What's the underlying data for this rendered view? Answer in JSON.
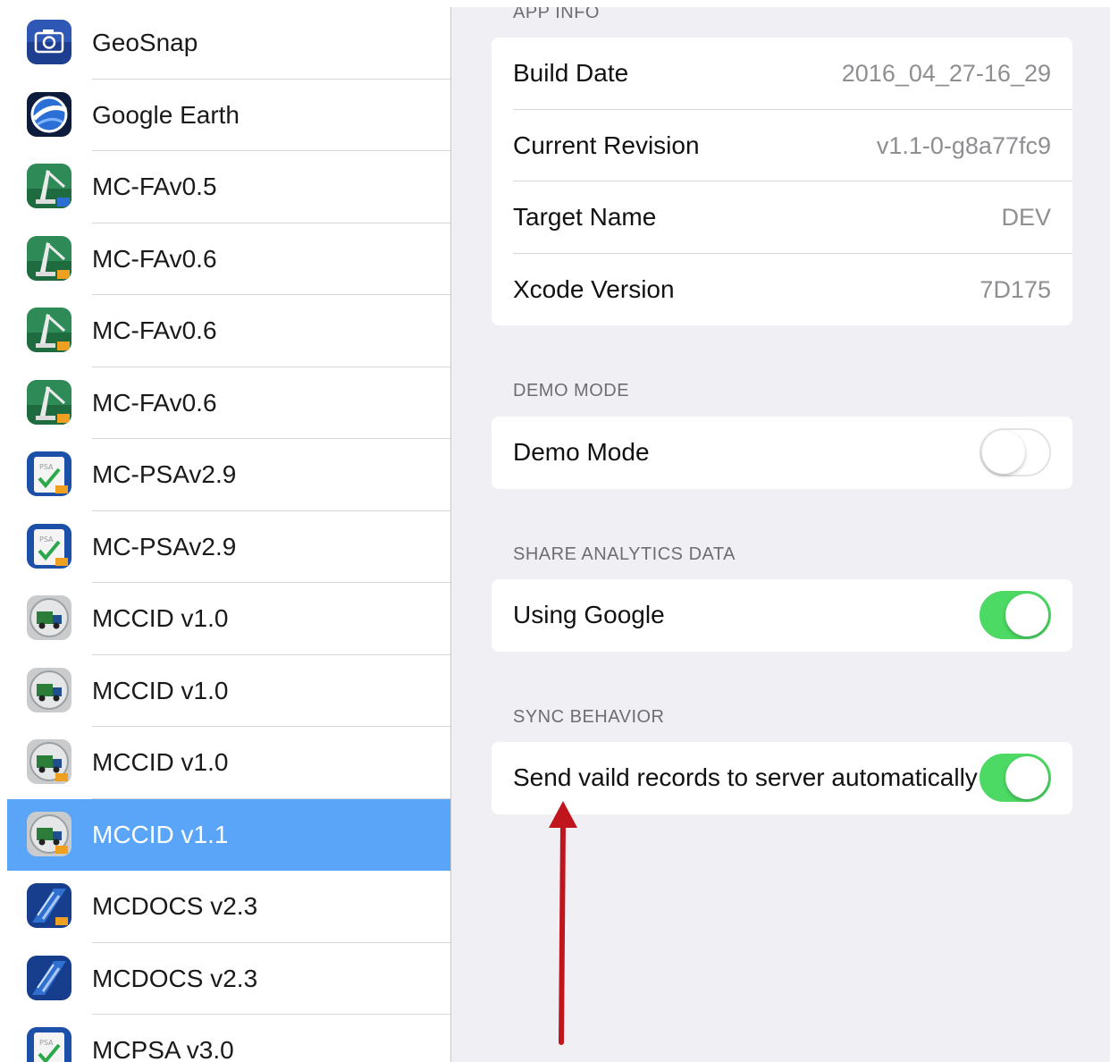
{
  "sidebar": {
    "apps": [
      {
        "name": "GeoSnap",
        "icon": "geosnap-camera-icon",
        "selected": false
      },
      {
        "name": "Google Earth",
        "icon": "google-earth-icon",
        "selected": false
      },
      {
        "name": "MC-FAv0.5",
        "icon": "mc-fa-crane-icon",
        "selected": false
      },
      {
        "name": "MC-FAv0.6",
        "icon": "mc-fa-crane-icon",
        "selected": false
      },
      {
        "name": "MC-FAv0.6",
        "icon": "mc-fa-crane-icon",
        "selected": false
      },
      {
        "name": "MC-FAv0.6",
        "icon": "mc-fa-crane-icon",
        "selected": false
      },
      {
        "name": "MC-PSAv2.9",
        "icon": "mc-psa-checklist-icon",
        "selected": false
      },
      {
        "name": "MC-PSAv2.9",
        "icon": "mc-psa-checklist-icon",
        "selected": false
      },
      {
        "name": "MCCID v1.0",
        "icon": "mccid-truck-icon",
        "selected": false
      },
      {
        "name": "MCCID v1.0",
        "icon": "mccid-truck-icon",
        "selected": false
      },
      {
        "name": "MCCID v1.0",
        "icon": "mccid-truck-icon",
        "selected": false
      },
      {
        "name": "MCCID v1.1",
        "icon": "mccid-truck-icon",
        "selected": true
      },
      {
        "name": "MCDOCS v2.3",
        "icon": "mcdocs-icon",
        "selected": false
      },
      {
        "name": "MCDOCS v2.3",
        "icon": "mcdocs-icon",
        "selected": false
      },
      {
        "name": "MCPSA v3.0",
        "icon": "mc-psa-checklist-icon",
        "selected": false
      }
    ]
  },
  "detail": {
    "app_info": {
      "header": "APP INFO",
      "rows": [
        {
          "label": "Build Date",
          "value": "2016_04_27-16_29"
        },
        {
          "label": "Current Revision",
          "value": "v1.1-0-g8a77fc9"
        },
        {
          "label": "Target Name",
          "value": "DEV"
        },
        {
          "label": "Xcode Version",
          "value": "7D175"
        }
      ]
    },
    "demo_mode": {
      "header": "DEMO MODE",
      "label": "Demo Mode",
      "on": false
    },
    "share_analytics": {
      "header": "SHARE ANALYTICS DATA",
      "label": "Using Google",
      "on": true
    },
    "sync_behavior": {
      "header": "SYNC BEHAVIOR",
      "label": "Send vaild records to server automatically",
      "on": true
    }
  },
  "colors": {
    "selected_row": "#5aa5f8",
    "toggle_on": "#4cd964",
    "annotation_arrow": "#c0151c"
  }
}
